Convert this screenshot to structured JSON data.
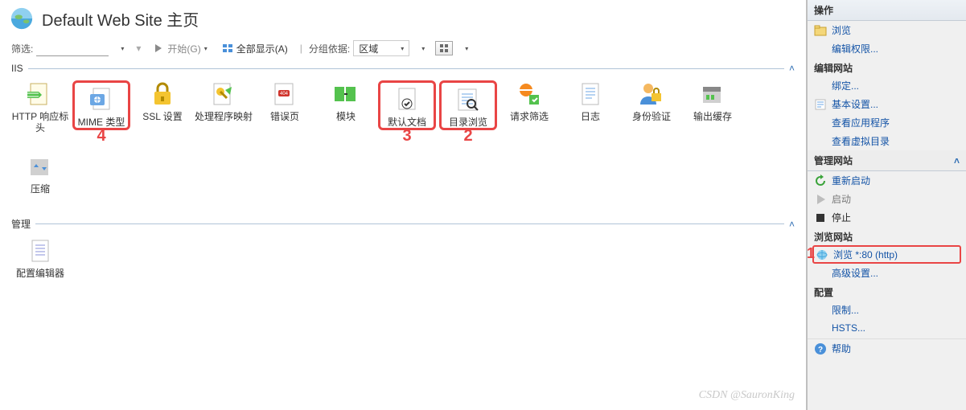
{
  "header": {
    "title": "Default Web Site 主页"
  },
  "toolbar": {
    "filter_label": "筛选:",
    "start_label": "开始(G)",
    "show_all_label": "全部显示(A)",
    "group_label": "分组依据:",
    "group_value": "区域"
  },
  "sections": {
    "iis": {
      "label": "IIS",
      "items": [
        {
          "label": "HTTP 响应标头"
        },
        {
          "label": "MIME 类型",
          "callout": "4"
        },
        {
          "label": "SSL 设置"
        },
        {
          "label": "处理程序映射"
        },
        {
          "label": "错误页"
        },
        {
          "label": "模块"
        },
        {
          "label": "默认文档",
          "callout": "3"
        },
        {
          "label": "目录浏览",
          "callout": "2"
        },
        {
          "label": "请求筛选"
        },
        {
          "label": "日志"
        },
        {
          "label": "身份验证"
        },
        {
          "label": "输出缓存"
        },
        {
          "label": "压缩"
        }
      ]
    },
    "manage": {
      "label": "管理",
      "items": [
        {
          "label": "配置编辑器"
        }
      ]
    }
  },
  "sidebar": {
    "header_ops": "操作",
    "explore": "浏览",
    "edit_perm": "编辑权限...",
    "sub_edit_site": "编辑网站",
    "bindings": "绑定...",
    "basic_settings": "基本设置...",
    "view_apps": "查看应用程序",
    "view_vdirs": "查看虚拟目录",
    "header_manage_site": "管理网站",
    "restart": "重新启动",
    "start": "启动",
    "stop": "停止",
    "sub_browse_site": "浏览网站",
    "browse_http": "浏览 *:80 (http)",
    "browse_callout": "1",
    "advanced": "高级设置...",
    "sub_config": "配置",
    "limits": "限制...",
    "hsts": "HSTS...",
    "help": "帮助"
  },
  "watermark": "CSDN @SauronKing"
}
